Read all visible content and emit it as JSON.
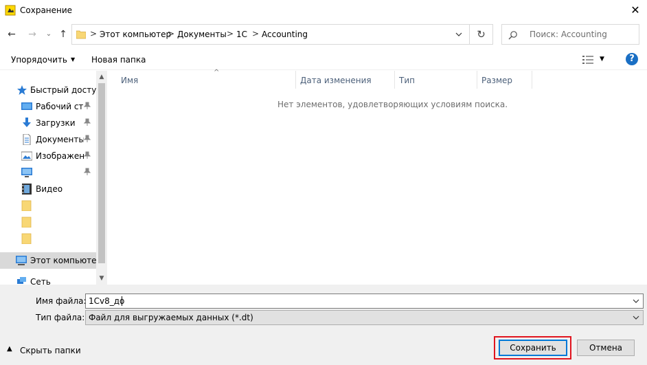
{
  "window": {
    "title": "Сохранение",
    "close_glyph": "✕"
  },
  "nav": {
    "back_glyph": "←",
    "forward_glyph": "→",
    "recent_glyph": "⌄",
    "up_glyph": "↑",
    "breadcrumbs": [
      "Этот компьютер",
      "Документы",
      "1C",
      "Accounting"
    ],
    "crumb_sep": ">",
    "refresh_glyph": "↻",
    "search_placeholder": "Поиск: Accounting"
  },
  "toolbar": {
    "organize": "Упорядочить",
    "new_folder": "Новая папка",
    "help": "?"
  },
  "sidebar": {
    "items": [
      {
        "label": "Быстрый доступ",
        "icon": "star-icon"
      },
      {
        "label": "Рабочий стол",
        "icon": "desktop-icon",
        "pinned": true
      },
      {
        "label": "Загрузки",
        "icon": "download-icon",
        "pinned": true
      },
      {
        "label": "Документы",
        "icon": "document-icon",
        "pinned": true
      },
      {
        "label": "Изображения",
        "icon": "picture-icon",
        "pinned": true
      },
      {
        "label": "",
        "icon": "monitor-icon",
        "pinned": true
      },
      {
        "label": "Видео",
        "icon": "video-icon"
      },
      {
        "label": "",
        "icon": "folder-icon"
      },
      {
        "label": "",
        "icon": "folder-icon"
      },
      {
        "label": "",
        "icon": "folder-icon"
      },
      {
        "label": "Этот компьютер",
        "icon": "computer-icon",
        "selected": true
      },
      {
        "label": "Сеть",
        "icon": "network-icon"
      }
    ]
  },
  "list": {
    "columns": [
      "Имя",
      "Дата изменения",
      "Тип",
      "Размер"
    ],
    "sort_glyph": "^",
    "empty_message": "Нет элементов, удовлетворяющих условиям поиска."
  },
  "form": {
    "filename_label": "Имя файла:",
    "filename_value": "1Cv8_до",
    "filetype_label": "Тип файла:",
    "filetype_value": "Файл для выгружаемых данных (*.dt)",
    "hide_folders": "Скрыть папки",
    "hide_glyph": "▲",
    "save": "Сохранить",
    "cancel": "Отмена"
  },
  "colors": {
    "accent": "#0078d7",
    "highlight_outline": "#e0141e",
    "folder": "#f8d775",
    "header_text": "#4c607a"
  }
}
